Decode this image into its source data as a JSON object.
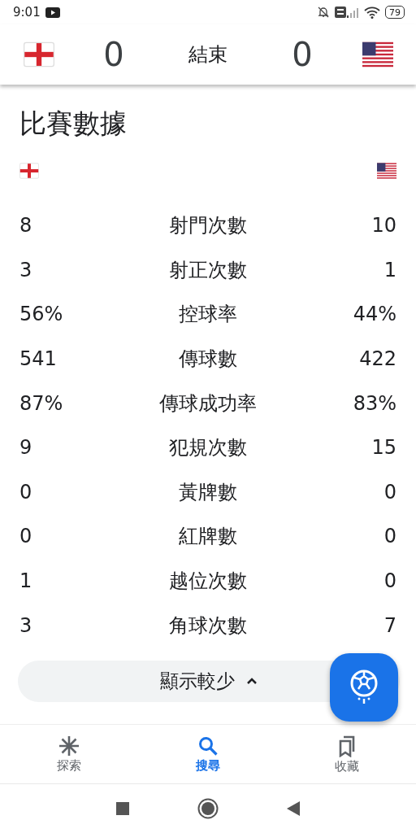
{
  "status_bar": {
    "time": "9:01",
    "battery": "79"
  },
  "match": {
    "home_score": "0",
    "status": "結束",
    "away_score": "0"
  },
  "stats": {
    "title": "比賽數據",
    "rows": [
      {
        "home": "8",
        "label": "射門次數",
        "away": "10"
      },
      {
        "home": "3",
        "label": "射正次數",
        "away": "1"
      },
      {
        "home": "56%",
        "label": "控球率",
        "away": "44%"
      },
      {
        "home": "541",
        "label": "傳球數",
        "away": "422"
      },
      {
        "home": "87%",
        "label": "傳球成功率",
        "away": "83%"
      },
      {
        "home": "9",
        "label": "犯規次數",
        "away": "15"
      },
      {
        "home": "0",
        "label": "黃牌數",
        "away": "0"
      },
      {
        "home": "0",
        "label": "紅牌數",
        "away": "0"
      },
      {
        "home": "1",
        "label": "越位次數",
        "away": "0"
      },
      {
        "home": "3",
        "label": "角球次數",
        "away": "7"
      }
    ],
    "toggle": {
      "label": "顯示較少",
      "expanded": true
    }
  },
  "bottom_nav": [
    {
      "label": "探索",
      "kind": "explore",
      "selected": false
    },
    {
      "label": "搜尋",
      "kind": "search",
      "selected": true
    },
    {
      "label": "收藏",
      "kind": "saved",
      "selected": false
    }
  ]
}
